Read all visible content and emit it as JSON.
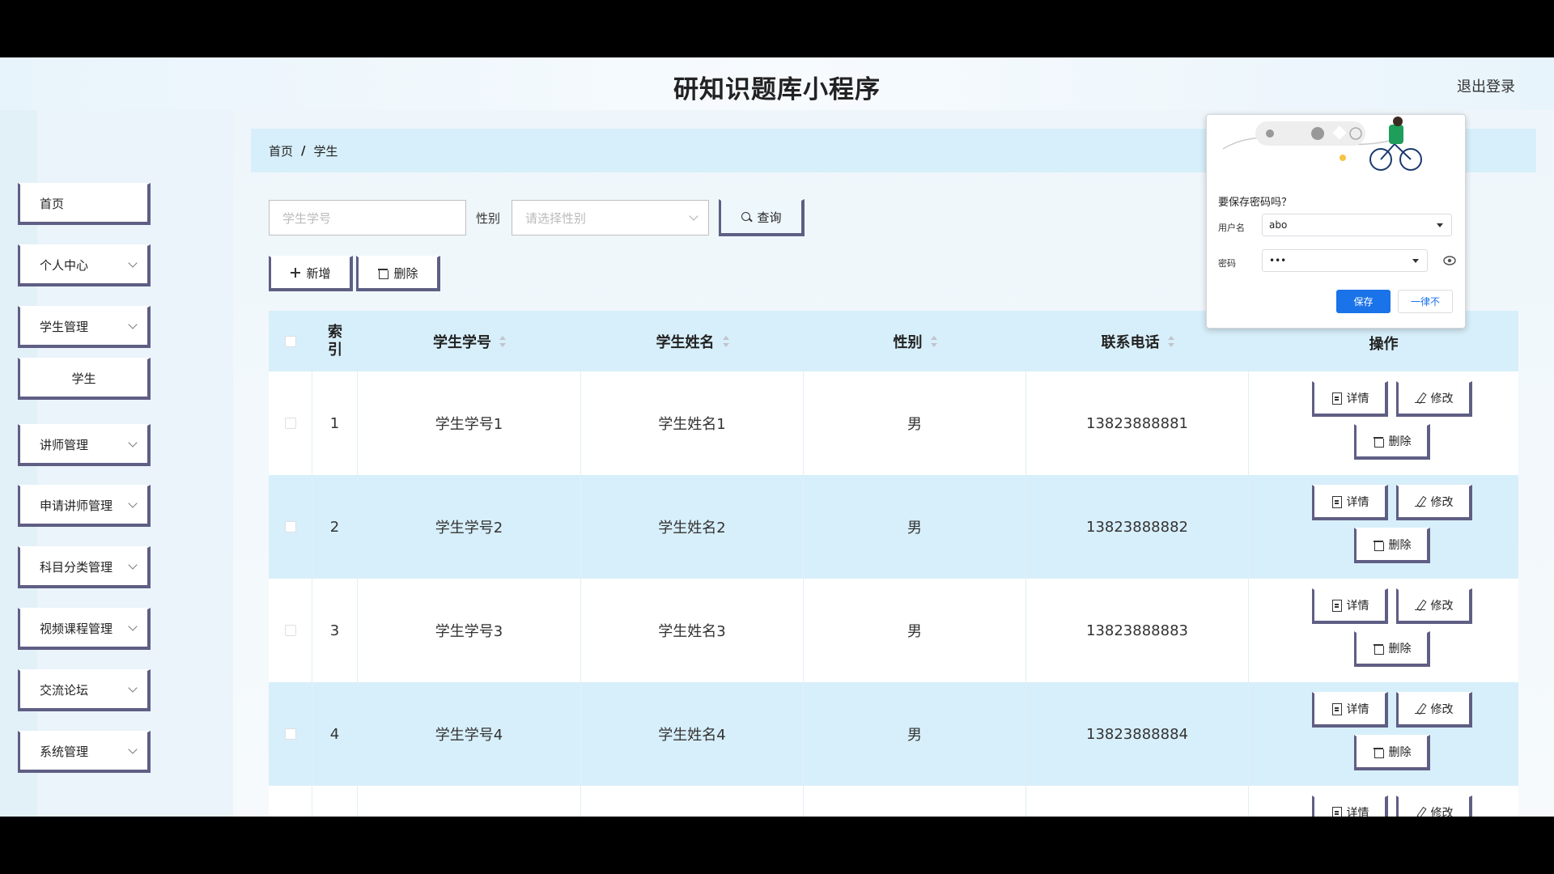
{
  "header": {
    "title": "研知识题库小程序",
    "logout": "退出登录"
  },
  "sidebar": {
    "items": [
      {
        "label": "首页",
        "expandable": false
      },
      {
        "label": "个人中心",
        "expandable": true
      },
      {
        "label": "学生管理",
        "expandable": true
      },
      {
        "label": "学生",
        "expandable": false,
        "sub": true
      },
      {
        "label": "讲师管理",
        "expandable": true
      },
      {
        "label": "申请讲师管理",
        "expandable": true
      },
      {
        "label": "科目分类管理",
        "expandable": true
      },
      {
        "label": "视频课程管理",
        "expandable": true
      },
      {
        "label": "交流论坛",
        "expandable": true
      },
      {
        "label": "系统管理",
        "expandable": true
      }
    ]
  },
  "breadcrumb": {
    "home": "首页",
    "separator": "/",
    "current": "学生"
  },
  "search": {
    "student_no_placeholder": "学生学号",
    "gender_label": "性别",
    "gender_placeholder": "请选择性别",
    "query_button": "查询"
  },
  "toolbar": {
    "add": "新增",
    "delete": "删除"
  },
  "table": {
    "columns": [
      "索引",
      "学生学号",
      "学生姓名",
      "性别",
      "联系电话",
      "操作"
    ],
    "rows": [
      {
        "index": "1",
        "student_no": "学生学号1",
        "name": "学生姓名1",
        "gender": "男",
        "phone": "13823888881"
      },
      {
        "index": "2",
        "student_no": "学生学号2",
        "name": "学生姓名2",
        "gender": "男",
        "phone": "13823888882"
      },
      {
        "index": "3",
        "student_no": "学生学号3",
        "name": "学生姓名3",
        "gender": "男",
        "phone": "13823888883"
      },
      {
        "index": "4",
        "student_no": "学生学号4",
        "name": "学生姓名4",
        "gender": "男",
        "phone": "13823888884"
      }
    ],
    "actions": {
      "detail": "详情",
      "edit": "修改",
      "delete": "删除"
    }
  },
  "password_popup": {
    "question": "要保存密码吗？",
    "username_label": "用户名",
    "username_value": "abo",
    "password_label": "密码",
    "password_value": "•••",
    "save": "保存",
    "never": "一律不"
  },
  "colors": {
    "accent": "#5f5e84",
    "row_highlight": "#d7effa",
    "primary_blue": "#1a73e8"
  }
}
